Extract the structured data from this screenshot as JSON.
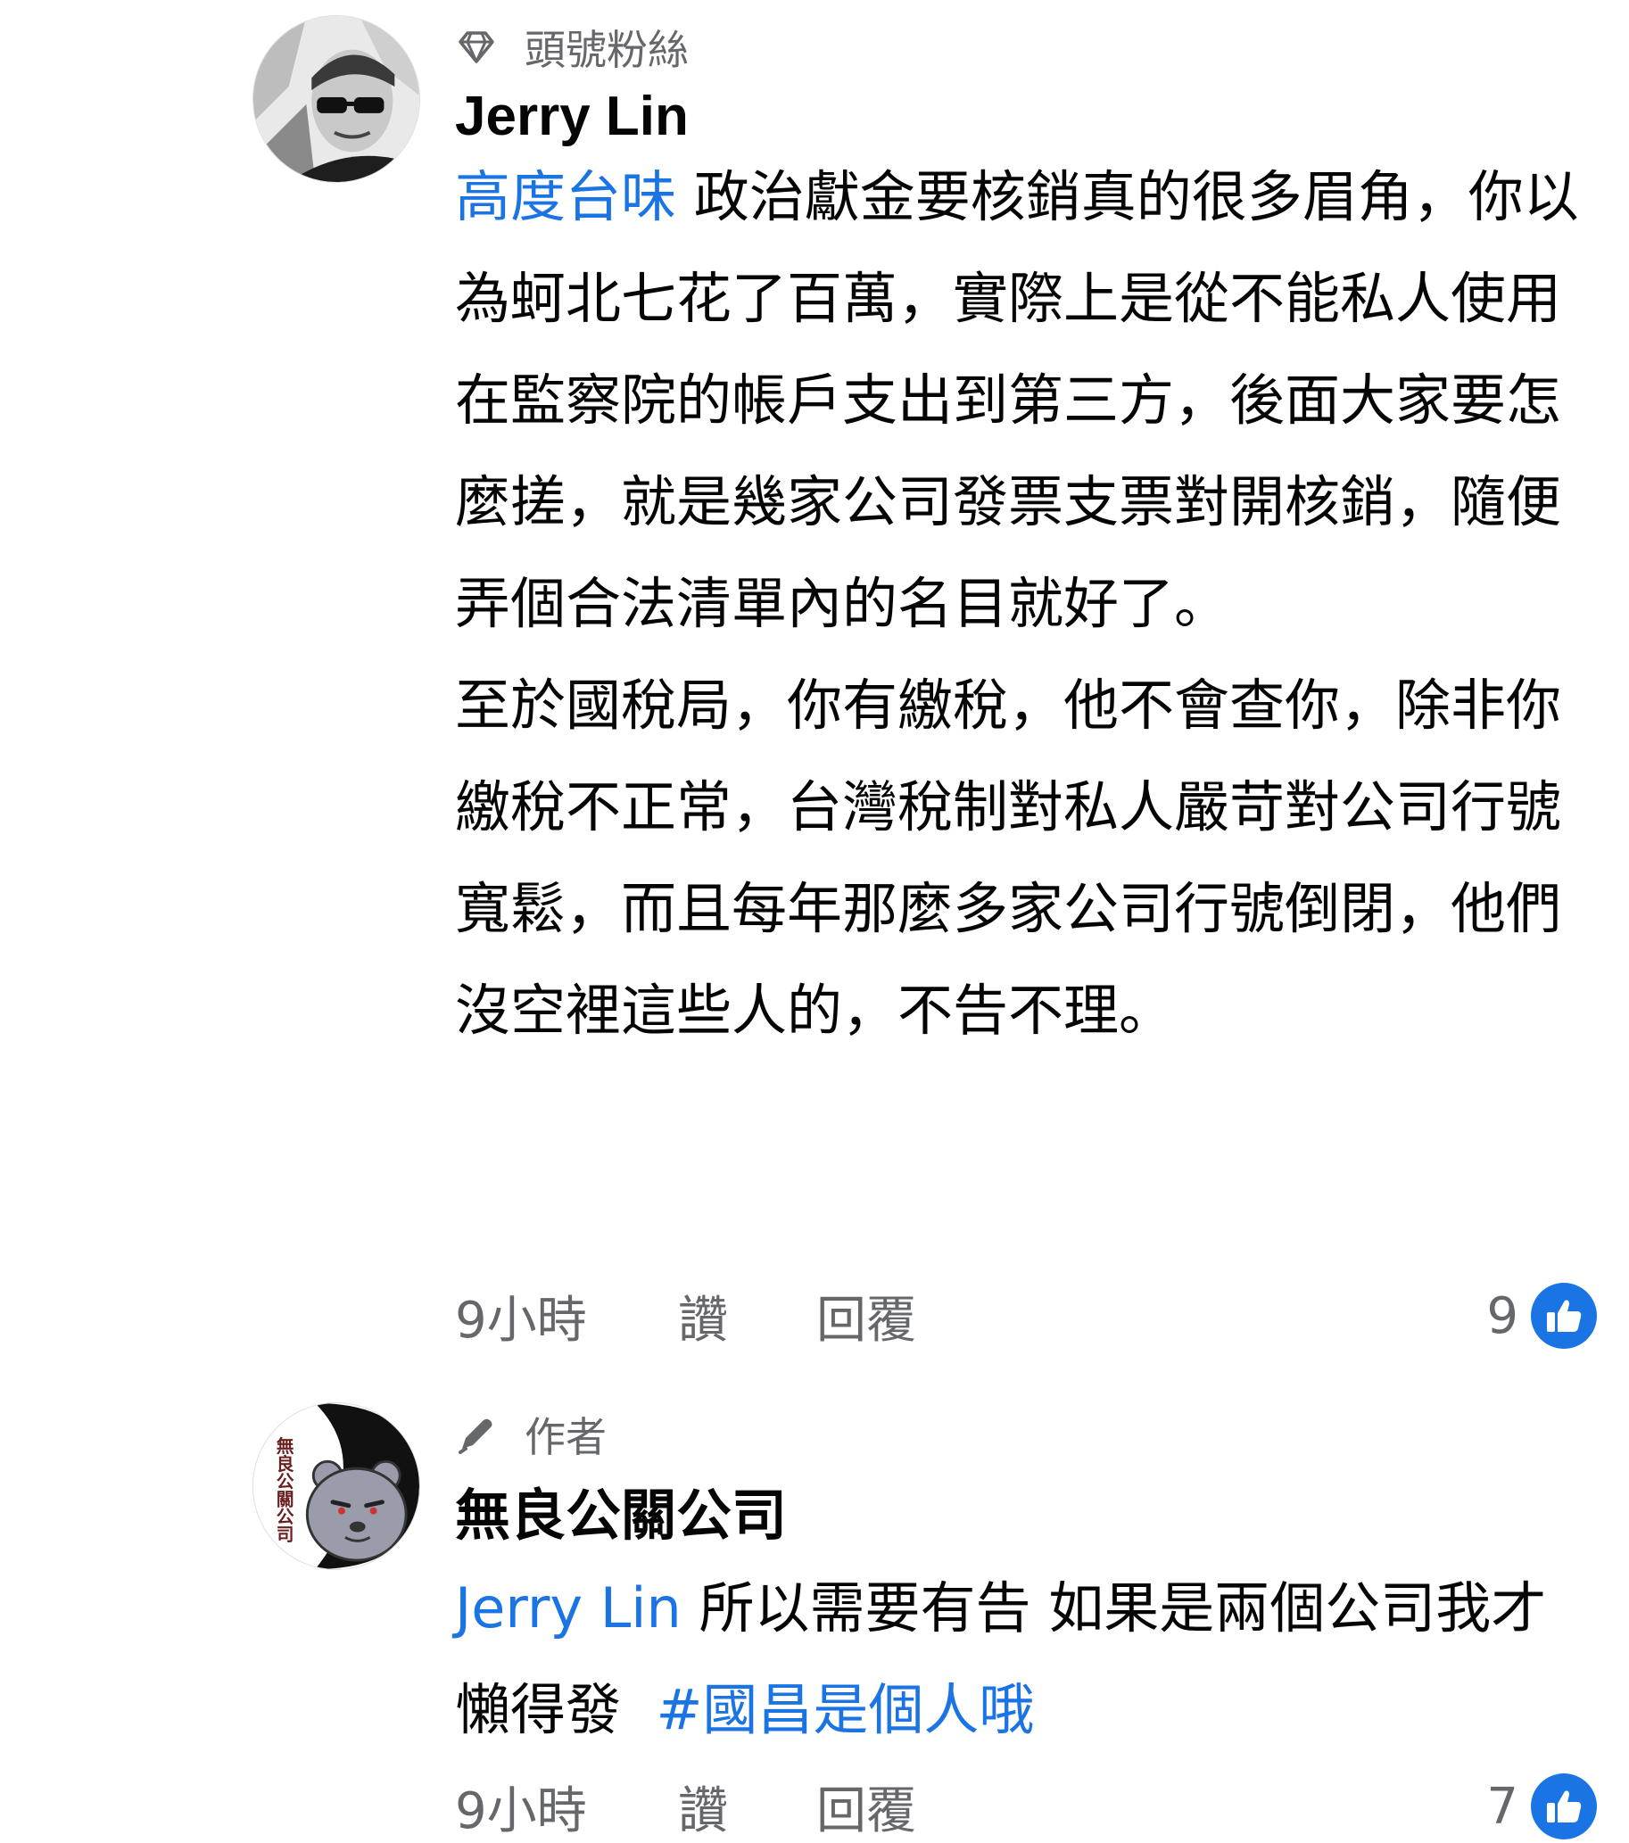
{
  "comments": [
    {
      "badge_icon": "diamond-icon",
      "badge_label": "頭號粉絲",
      "author": "Jerry Lin",
      "mention": "高度台味",
      "paragraphs": [
        "政治獻金要核銷真的很多眉角，你以為蚵北七花了百萬，實際上是從不能私人使用在監察院的帳戶支出到第三方，後面大家要怎麼搓，就是幾家公司發票支票對開核銷，隨便弄個合法清單內的名目就好了。",
        "至於國稅局，你有繳稅，他不會查你，除非你繳稅不正常，台灣稅制對私人嚴苛對公司行號寬鬆，而且每年那麼多家公司行號倒閉，他們沒空裡這些人的，不告不理。"
      ],
      "time": "9小時",
      "like_label": "讚",
      "reply_label": "回覆",
      "reaction_count": "9"
    },
    {
      "badge_icon": "pen-icon",
      "badge_label": "作者",
      "author": "無良公關公司",
      "avatar_text": "無良公關公司",
      "mention": "Jerry Lin",
      "text": "所以需要有告  如果是兩個公司我才懶得發",
      "hashtag": "#國昌是個人哦",
      "time": "9小時",
      "like_label": "讚",
      "reply_label": "回覆",
      "reaction_count": "7"
    }
  ],
  "colors": {
    "link_blue": "#1b74e4",
    "secondary_gray": "#65676b",
    "text_dark": "#050505"
  }
}
